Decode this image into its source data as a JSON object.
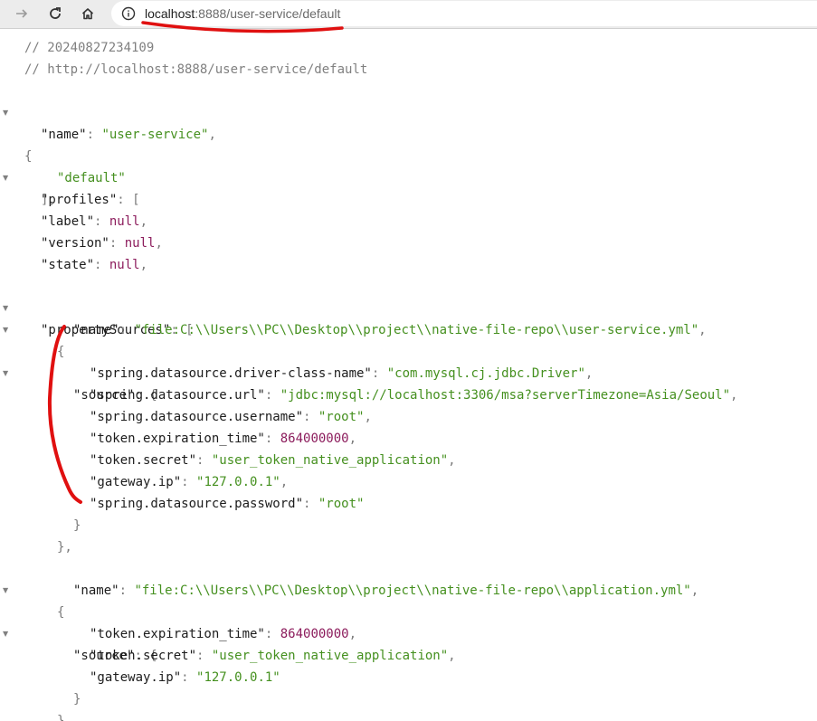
{
  "browser": {
    "back_icon": "arrow-right-icon",
    "reload_icon": "reload-icon",
    "home_icon": "home-icon",
    "info_icon": "info-icon",
    "url_host": "localhost",
    "url_rest": ":8888/user-service/default"
  },
  "comments": {
    "timestamp": "// 20240827234109",
    "source_url": "// http://localhost:8888/user-service/default"
  },
  "json": {
    "k_name": "\"name\"",
    "v_name": "\"user-service\"",
    "k_profiles": "\"profiles\"",
    "v_profile_0": "\"default\"",
    "k_label": "\"label\"",
    "v_label": "null",
    "k_version": "\"version\"",
    "v_version": "null",
    "k_state": "\"state\"",
    "v_state": "null",
    "k_propertySources": "\"propertySources\"",
    "ps0": {
      "k_name": "\"name\"",
      "v_name": "\"file:C:\\\\Users\\\\PC\\\\Desktop\\\\project\\\\native-file-repo\\\\user-service.yml\"",
      "k_source": "\"source\"",
      "entries": [
        {
          "k": "\"spring.datasource.driver-class-name\"",
          "v": "\"com.mysql.cj.jdbc.Driver\"",
          "t": "str"
        },
        {
          "k": "\"spring.datasource.url\"",
          "v": "\"jdbc:mysql://localhost:3306/msa?serverTimezone=Asia/Seoul\"",
          "t": "str"
        },
        {
          "k": "\"spring.datasource.username\"",
          "v": "\"root\"",
          "t": "str"
        },
        {
          "k": "\"token.expiration_time\"",
          "v": "864000000",
          "t": "num"
        },
        {
          "k": "\"token.secret\"",
          "v": "\"user_token_native_application\"",
          "t": "str"
        },
        {
          "k": "\"gateway.ip\"",
          "v": "\"127.0.0.1\"",
          "t": "str"
        },
        {
          "k": "\"spring.datasource.password\"",
          "v": "\"root\"",
          "t": "str"
        }
      ]
    },
    "ps1": {
      "k_name": "\"name\"",
      "v_name": "\"file:C:\\\\Users\\\\PC\\\\Desktop\\\\project\\\\native-file-repo\\\\application.yml\"",
      "k_source": "\"source\"",
      "entries": [
        {
          "k": "\"token.expiration_time\"",
          "v": "864000000",
          "t": "num"
        },
        {
          "k": "\"token.secret\"",
          "v": "\"user_token_native_application\"",
          "t": "str"
        },
        {
          "k": "\"gateway.ip\"",
          "v": "\"127.0.0.1\"",
          "t": "str"
        }
      ]
    }
  },
  "colors": {
    "string": "#45901f",
    "number": "#8c1c5c",
    "annotation": "#e01010"
  }
}
